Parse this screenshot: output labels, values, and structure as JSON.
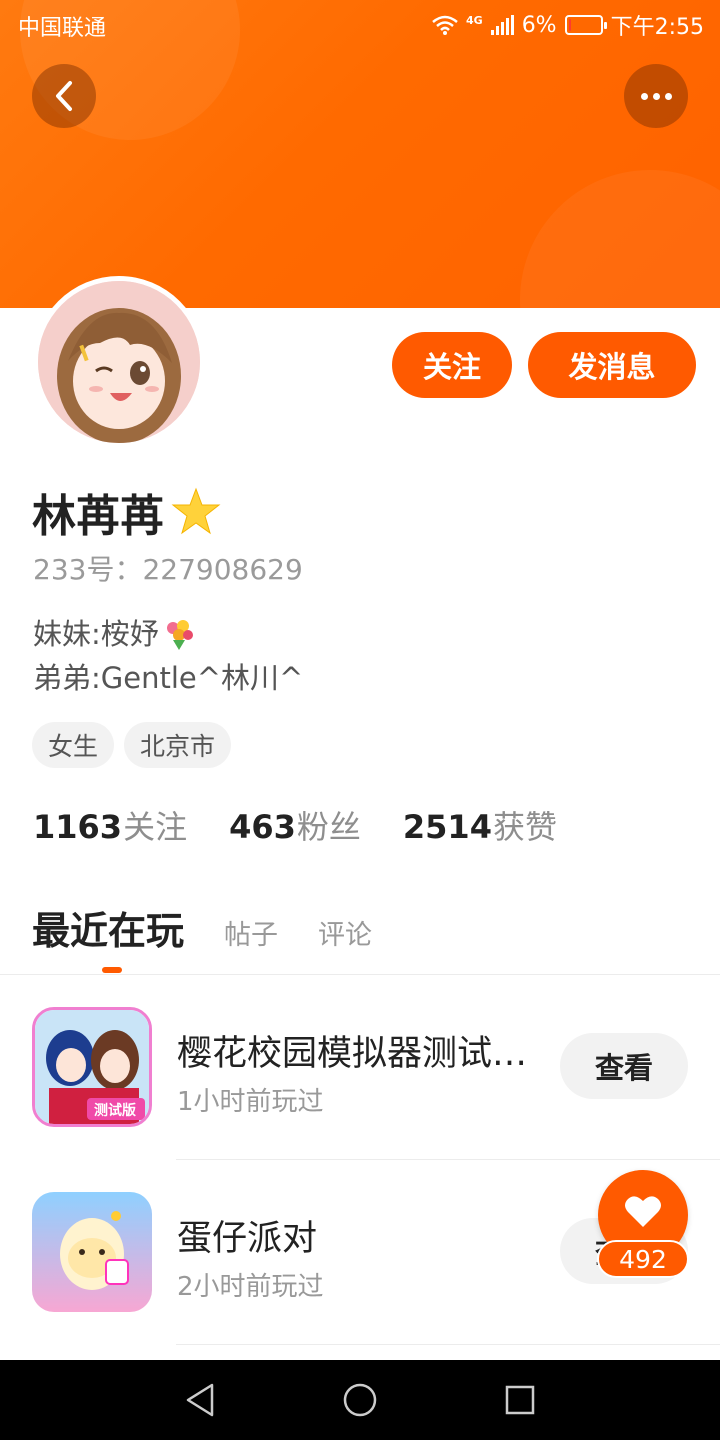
{
  "statusbar": {
    "carrier": "中国联通",
    "network": "4G",
    "battery": "6%",
    "battery_level": 0.06,
    "time": "下午2:55"
  },
  "header": {
    "back_icon": "back-arrow-icon",
    "more_icon": "more-dots-icon"
  },
  "profile": {
    "name": "林苒苒",
    "name_badge_icon": "star-icon",
    "uid": "233号：227908629",
    "bio_line1": "妹妹:桉妤",
    "bio_line1_icon": "flower-bouquet-icon",
    "bio_line2": "弟弟:Gentle^林川^",
    "tags": [
      "女生",
      "北京市"
    ],
    "follow_label": "关注",
    "message_label": "发消息"
  },
  "stats": [
    {
      "value": "1163",
      "label": "关注"
    },
    {
      "value": "463",
      "label": "粉丝"
    },
    {
      "value": "2514",
      "label": "获赞"
    }
  ],
  "tabs": {
    "active": "最近在玩",
    "items": [
      "帖子",
      "评论"
    ]
  },
  "games": [
    {
      "title": "樱花校园模拟器测试…",
      "time": "1小时前玩过",
      "view_label": "查看"
    },
    {
      "title": "蛋仔派对",
      "time": "2小时前玩过",
      "view_label": "查看"
    }
  ],
  "like_fab": {
    "count": "492",
    "icon": "heart-icon"
  },
  "colors": {
    "accent": "#ff5a00",
    "header": "#ff6a00"
  }
}
